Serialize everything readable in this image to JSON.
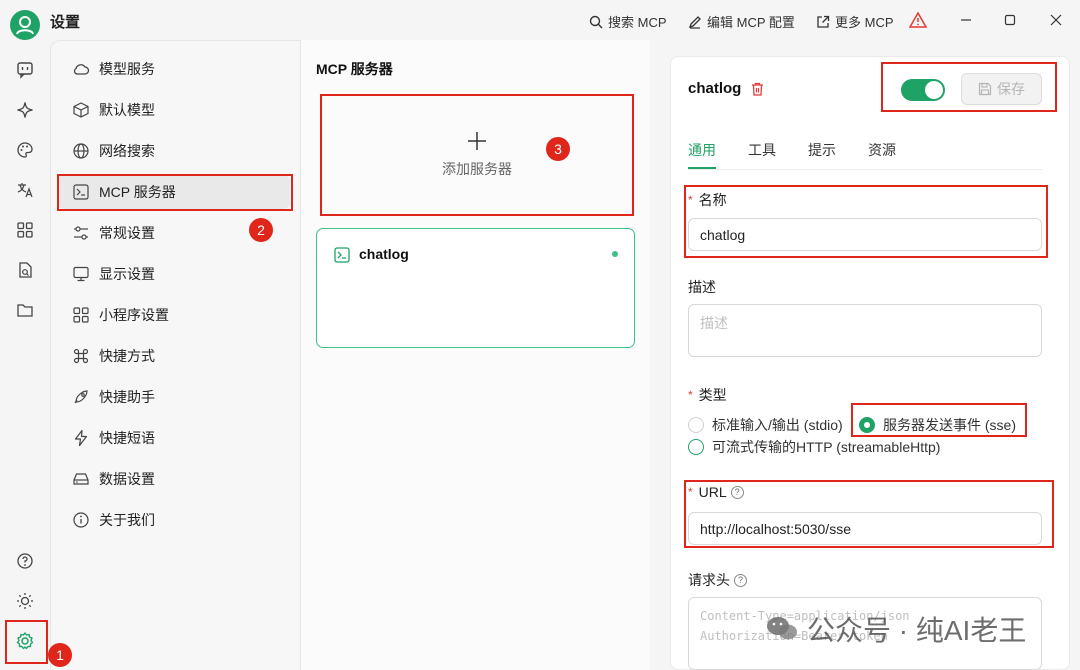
{
  "app": {
    "title": "设置"
  },
  "titlebar": {
    "search_mcp": "搜索 MCP",
    "edit_mcp": "编辑 MCP 配置",
    "more_mcp": "更多 MCP"
  },
  "nav": {
    "items": [
      {
        "label": "模型服务",
        "icon": "cloud-icon"
      },
      {
        "label": "默认模型",
        "icon": "cube-icon"
      },
      {
        "label": "网络搜索",
        "icon": "globe-icon"
      },
      {
        "label": "MCP 服务器",
        "icon": "terminal-icon",
        "active": true
      },
      {
        "label": "常规设置",
        "icon": "sliders-icon"
      },
      {
        "label": "显示设置",
        "icon": "monitor-icon"
      },
      {
        "label": "小程序设置",
        "icon": "grid-icon"
      },
      {
        "label": "快捷方式",
        "icon": "command-icon"
      },
      {
        "label": "快捷助手",
        "icon": "rocket-icon"
      },
      {
        "label": "快捷短语",
        "icon": "zap-icon"
      },
      {
        "label": "数据设置",
        "icon": "hard-drive-icon"
      },
      {
        "label": "关于我们",
        "icon": "info-icon"
      }
    ]
  },
  "mcp": {
    "title": "MCP 服务器",
    "add_label": "添加服务器",
    "servers": [
      {
        "name": "chatlog",
        "status": "active"
      }
    ]
  },
  "detail": {
    "name": "chatlog",
    "enabled": true,
    "save_label": "保存",
    "tabs": [
      "通用",
      "工具",
      "提示",
      "资源"
    ],
    "name_label": "名称",
    "name_value": "chatlog",
    "desc_label": "描述",
    "desc_placeholder": "描述",
    "type_label": "类型",
    "type_options": [
      {
        "label": "标准输入/输出 (stdio)",
        "selected": false
      },
      {
        "label": "服务器发送事件 (sse)",
        "selected": true
      },
      {
        "label": "可流式传输的HTTP (streamableHttp)",
        "selected": false
      }
    ],
    "url_label": "URL",
    "url_value": "http://localhost:5030/sse",
    "headers_label": "请求头",
    "headers_placeholder": "Content-Type=application/json\nAuthorization=Bearer token"
  },
  "annotations": {
    "badges": [
      "1",
      "2",
      "3"
    ]
  },
  "watermark": {
    "text": "公众号 · 纯AI老王"
  },
  "colors": {
    "accent": "#1fa266",
    "annotation": "#e0251b"
  }
}
